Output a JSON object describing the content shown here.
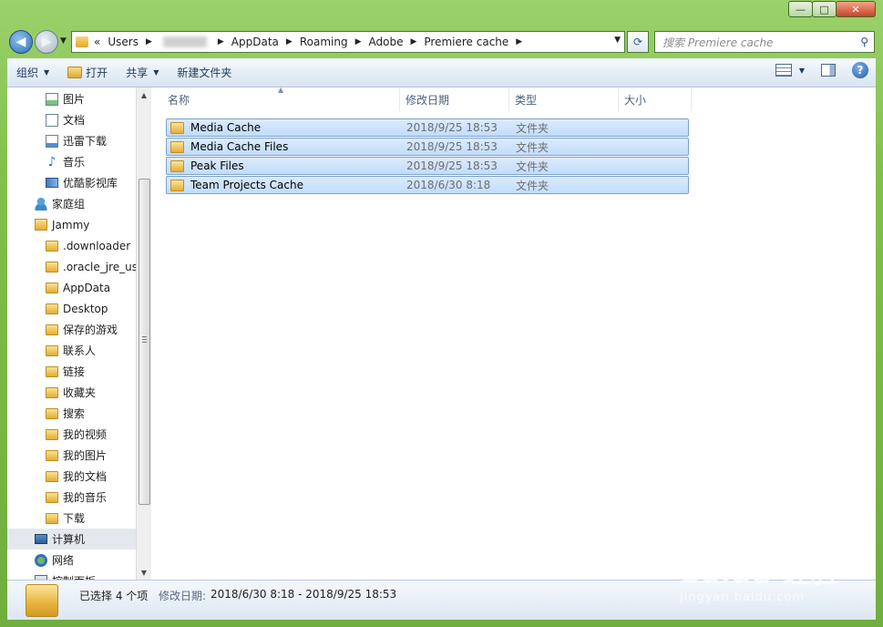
{
  "window": {
    "controls": {
      "minimize": "—",
      "maximize": "□",
      "close": "✕"
    }
  },
  "address": {
    "crumbs": [
      "Users",
      "AppData",
      "Roaming",
      "Adobe",
      "Premiere cache"
    ],
    "overflow_glyph": "«",
    "search_placeholder": "搜索 Premiere cache"
  },
  "toolbar": {
    "organize": "组织",
    "open": "打开",
    "share": "共享",
    "new_folder": "新建文件夹"
  },
  "nav": {
    "items": [
      {
        "label": "图片",
        "icon": "pictures-icon",
        "level": 1
      },
      {
        "label": "文档",
        "icon": "documents-icon",
        "level": 1
      },
      {
        "label": "迅雷下载",
        "icon": "thunder-downloads-icon",
        "level": 1
      },
      {
        "label": "音乐",
        "icon": "music-icon",
        "level": 1
      },
      {
        "label": "优酷影视库",
        "icon": "youku-library-icon",
        "level": 1
      },
      {
        "label": "家庭组",
        "icon": "homegroup-icon",
        "level": 0
      },
      {
        "label": "Jammy",
        "icon": "user-folder-icon",
        "level": 0
      },
      {
        "label": ".downloader",
        "icon": "folder-icon",
        "level": 1
      },
      {
        "label": ".oracle_jre_usa",
        "icon": "folder-icon",
        "level": 1
      },
      {
        "label": "AppData",
        "icon": "folder-icon",
        "level": 1
      },
      {
        "label": "Desktop",
        "icon": "folder-icon",
        "level": 1
      },
      {
        "label": "保存的游戏",
        "icon": "saved-games-icon",
        "level": 1
      },
      {
        "label": "联系人",
        "icon": "contacts-icon",
        "level": 1
      },
      {
        "label": "链接",
        "icon": "links-icon",
        "level": 1
      },
      {
        "label": "收藏夹",
        "icon": "favorites-icon",
        "level": 1
      },
      {
        "label": "搜索",
        "icon": "searches-icon",
        "level": 1
      },
      {
        "label": "我的视频",
        "icon": "my-videos-icon",
        "level": 1
      },
      {
        "label": "我的图片",
        "icon": "my-pictures-icon",
        "level": 1
      },
      {
        "label": "我的文档",
        "icon": "my-documents-icon",
        "level": 1
      },
      {
        "label": "我的音乐",
        "icon": "my-music-icon",
        "level": 1
      },
      {
        "label": "下载",
        "icon": "downloads-icon",
        "level": 1
      },
      {
        "label": "计算机",
        "icon": "computer-icon",
        "level": 0,
        "selected": true
      },
      {
        "label": "网络",
        "icon": "network-icon",
        "level": 0
      },
      {
        "label": "控制面板",
        "icon": "control-panel-icon",
        "level": 0
      }
    ]
  },
  "columns": {
    "name": "名称",
    "modified": "修改日期",
    "type": "类型",
    "size": "大小"
  },
  "files": [
    {
      "name": "Media Cache",
      "modified": "2018/9/25 18:53",
      "type": "文件夹",
      "selected": true
    },
    {
      "name": "Media Cache Files",
      "modified": "2018/9/25 18:53",
      "type": "文件夹",
      "selected": true
    },
    {
      "name": "Peak Files",
      "modified": "2018/9/25 18:53",
      "type": "文件夹",
      "selected": true
    },
    {
      "name": "Team Projects Cache",
      "modified": "2018/6/30 8:18",
      "type": "文件夹",
      "selected": true
    }
  ],
  "details": {
    "selection_count": "已选择 4 个项",
    "modified_label": "修改日期:",
    "modified_range": "2018/6/30 8:18 - 2018/9/25 18:53"
  },
  "watermark": {
    "main": "Baidu 经验",
    "sub": "jingyan.baidu.com"
  },
  "colors": {
    "selection_fill": "#c9e0fc",
    "selection_border": "#7da2ce",
    "frame": "#7fbf4b"
  }
}
